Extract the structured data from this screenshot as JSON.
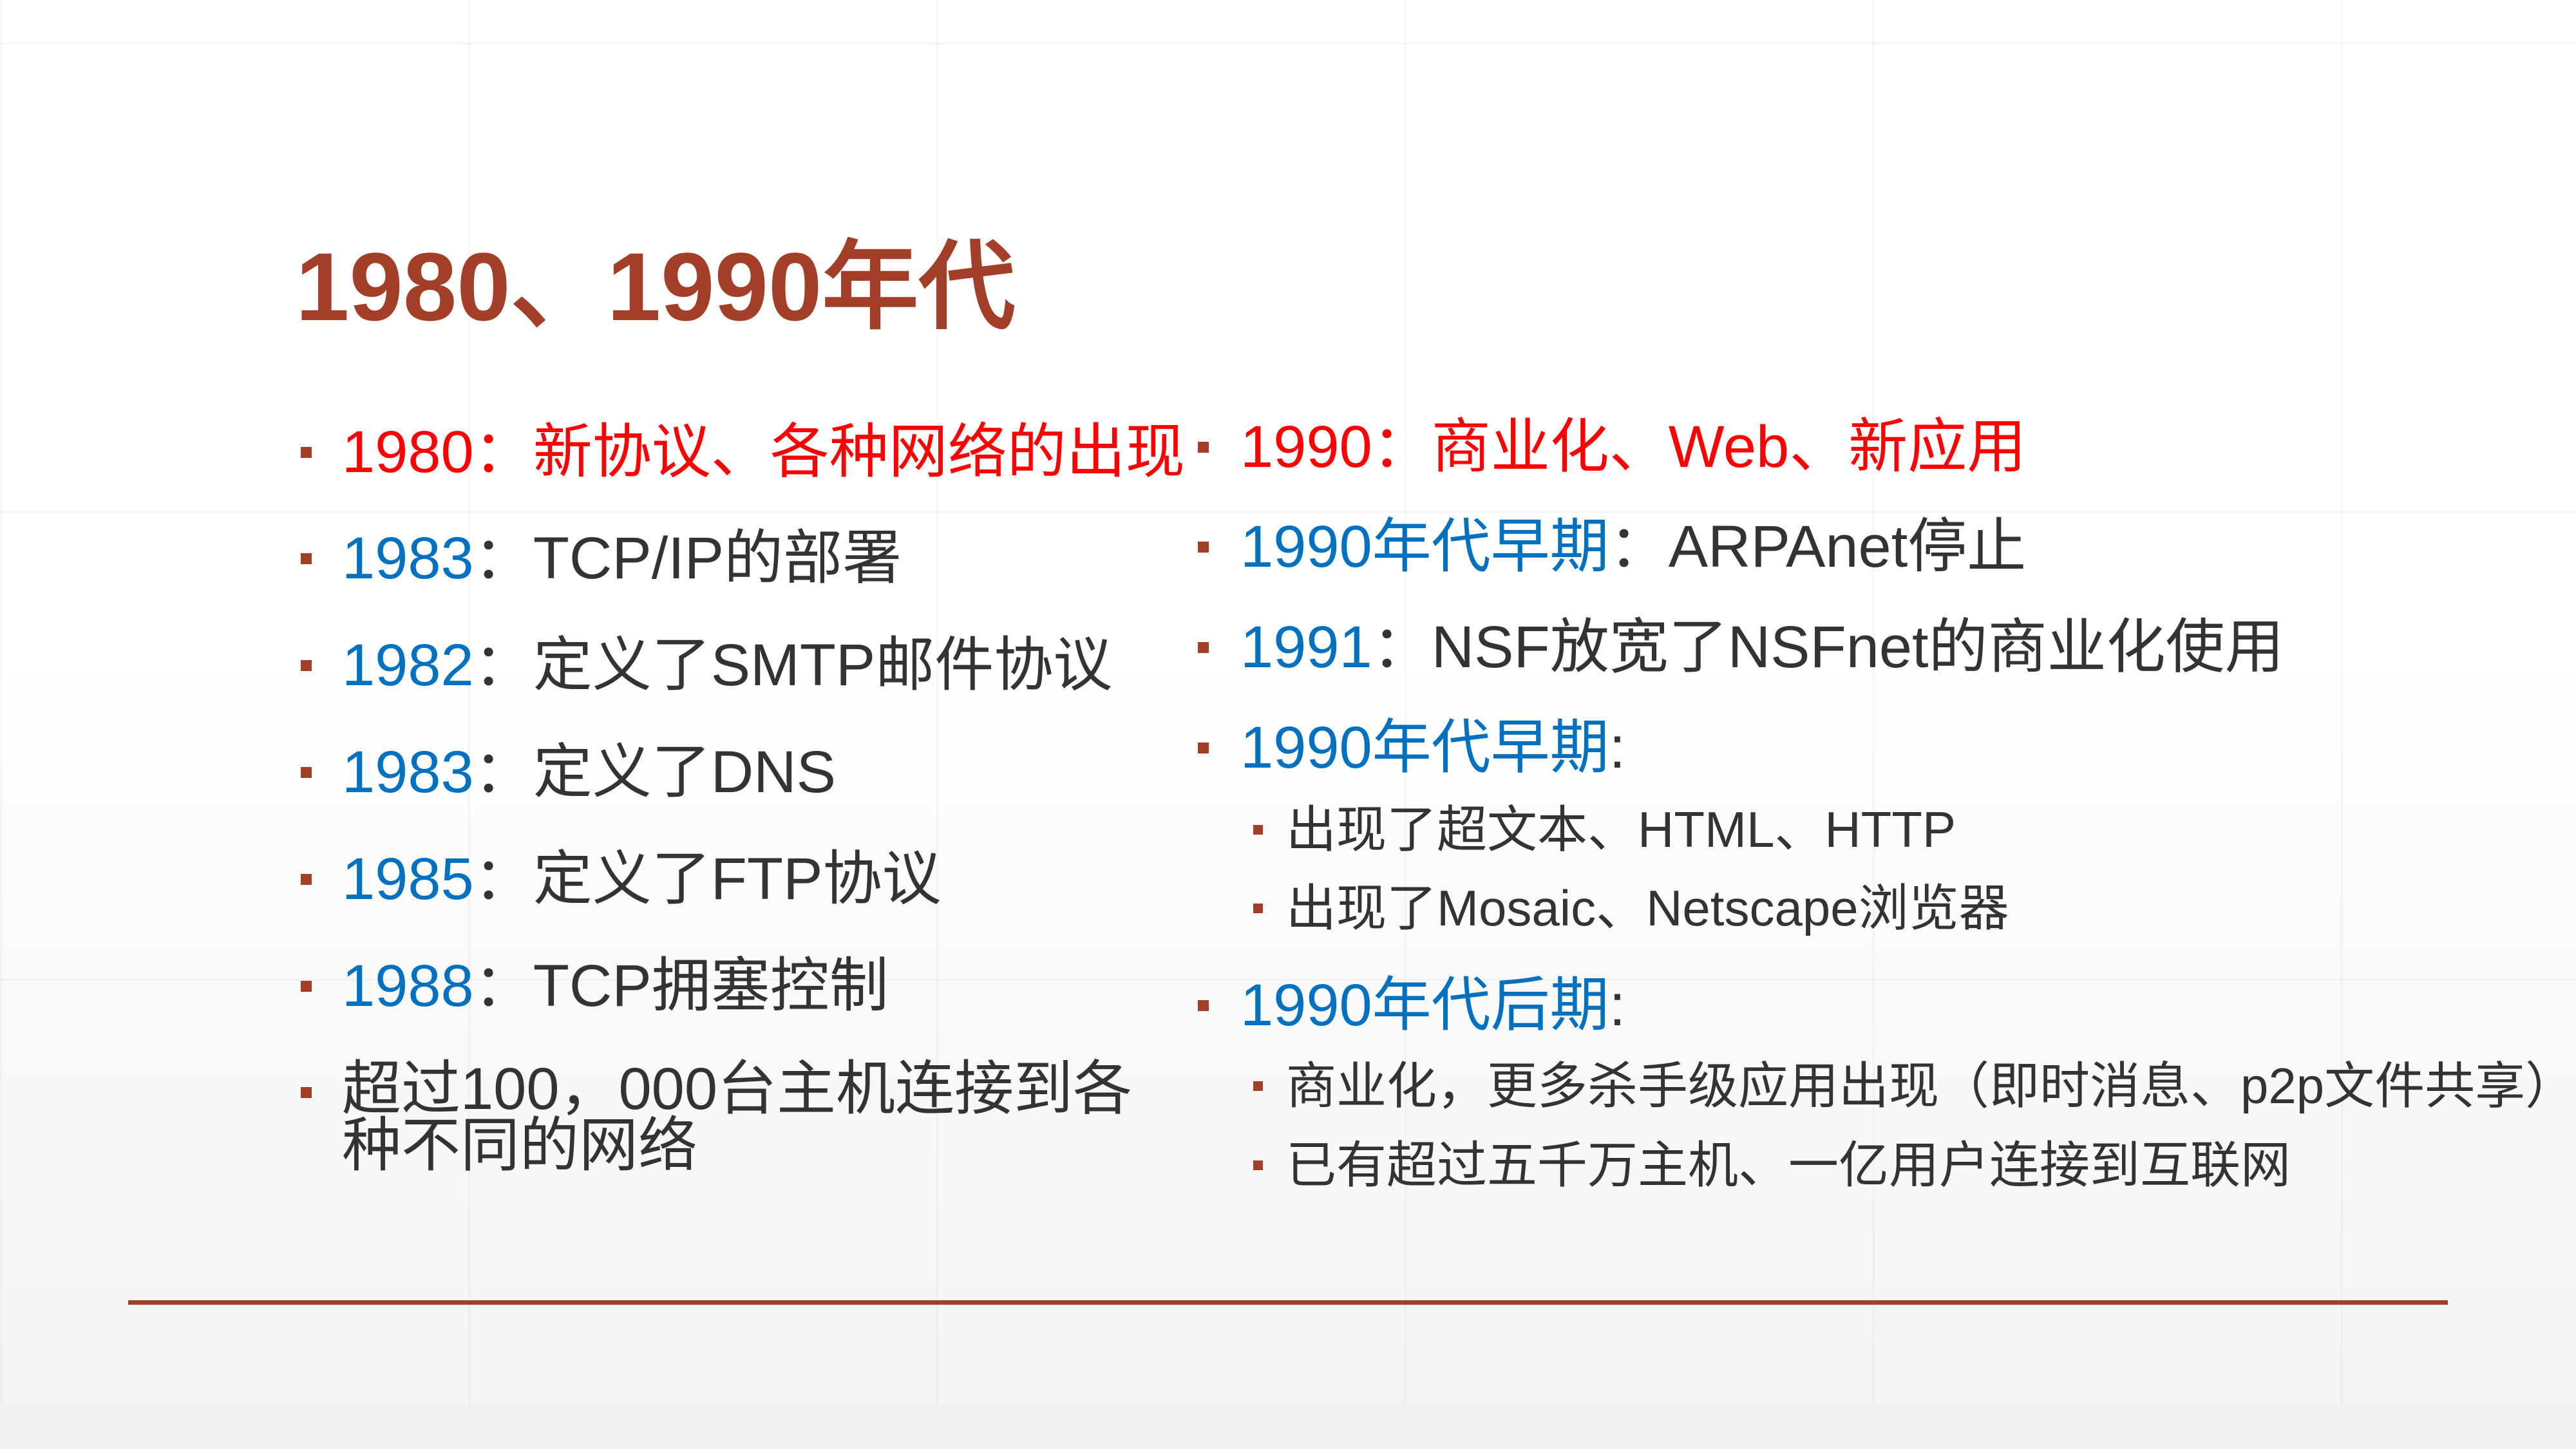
{
  "title": "1980、1990年代",
  "left": [
    {
      "year": "1980",
      "sep": "：",
      "text": "新协议、各种网络的出现",
      "year_color": "red",
      "text_color": "red"
    },
    {
      "year": "1983",
      "sep": "：",
      "text": "TCP/IP的部署",
      "year_color": "blue",
      "text_color": "dark"
    },
    {
      "year": "1982",
      "sep": "：",
      "text": "定义了SMTP邮件协议",
      "year_color": "blue",
      "text_color": "dark"
    },
    {
      "year": "1983",
      "sep": "：",
      "text": "定义了DNS",
      "year_color": "blue",
      "text_color": "dark"
    },
    {
      "year": "1985",
      "sep": "：",
      "text": "定义了FTP协议",
      "year_color": "blue",
      "text_color": "dark"
    },
    {
      "year": "1988",
      "sep": "：",
      "text": "TCP拥塞控制",
      "year_color": "blue",
      "text_color": "dark"
    },
    {
      "line1": "超过100，000台主机连接到各",
      "line2": "种不同的网络"
    }
  ],
  "right": [
    {
      "year": "1990",
      "sep": "：",
      "text": "商业化、Web、新应用"
    },
    {
      "year": "1990年代早期",
      "sep": "：",
      "text": "ARPAnet停止"
    },
    {
      "year": "1991",
      "sep": "：",
      "text": "NSF放宽了NSFnet的商业化使用"
    },
    {
      "year": "1990年代早期",
      "sep": ":",
      "subs": [
        "出现了超文本、HTML、HTTP",
        "出现了Mosaic、Netscape浏览器"
      ]
    },
    {
      "year": "1990年代后期",
      "sep": ":",
      "subs": [
        "商业化，更多杀手级应用出现（即时消息、p2p文件共享）",
        "已有超过五千万主机、一亿用户连接到互联网"
      ]
    }
  ],
  "colors": {
    "accent": "#A33F28",
    "red": "#FF0000",
    "blue": "#0070C0",
    "text": "#333333"
  }
}
